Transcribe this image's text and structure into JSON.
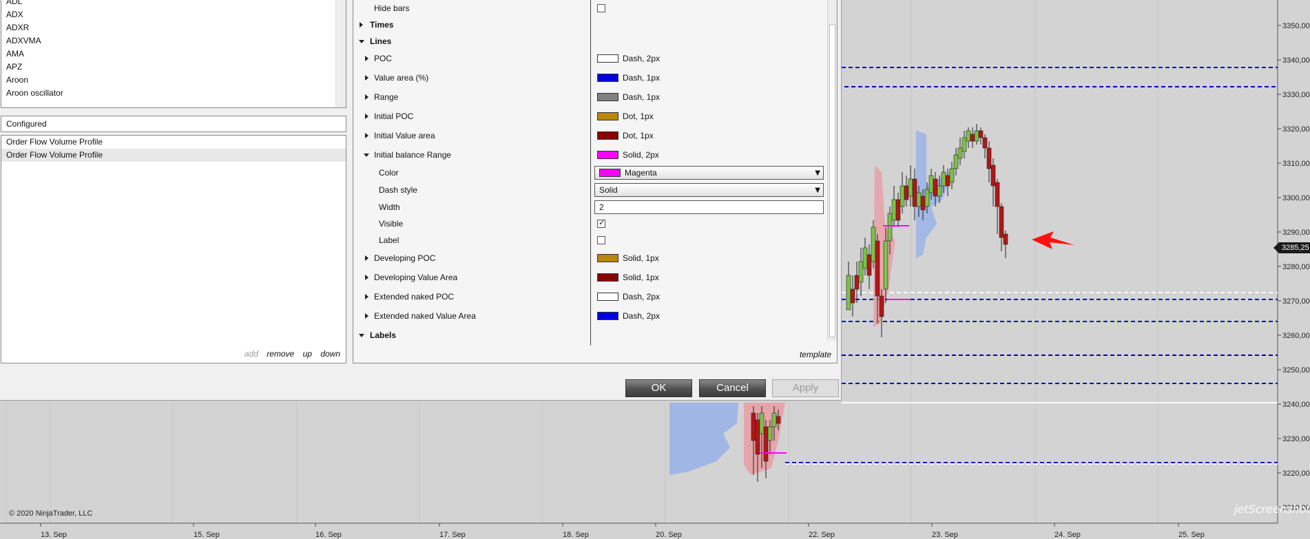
{
  "indicators": [
    "ADL",
    "ADX",
    "ADXR",
    "ADXVMA",
    "AMA",
    "APZ",
    "Aroon",
    "Aroon oscillator"
  ],
  "configured": {
    "header": "Configured",
    "items": [
      "Order Flow Volume Profile",
      "Order Flow Volume Profile"
    ],
    "actions": {
      "add": "add",
      "remove": "remove",
      "up": "up",
      "down": "down"
    }
  },
  "properties": {
    "hide_bars_label": "Hide bars",
    "times_label": "Times",
    "lines_label": "Lines",
    "labels_label": "Labels",
    "lines": [
      {
        "name": "POC",
        "color": "#ffffff",
        "value": "Dash, 2px"
      },
      {
        "name": "Value area (%)",
        "color": "#0000e0",
        "value": "Dash, 1px"
      },
      {
        "name": "Range",
        "color": "#808080",
        "value": "Dash, 1px"
      },
      {
        "name": "Initial POC",
        "color": "#b8860b",
        "value": "Dot, 1px"
      },
      {
        "name": "Initial Value area",
        "color": "#8b0000",
        "value": "Dot, 1px"
      },
      {
        "name": "Initial balance Range",
        "color": "#ff00ff",
        "value": "Solid, 2px"
      }
    ],
    "ib_sub": {
      "color_label": "Color",
      "color_value": "Magenta",
      "color_hex": "#ff00ff",
      "dash_label": "Dash style",
      "dash_value": "Solid",
      "width_label": "Width",
      "width_value": "2",
      "visible_label": "Visible",
      "label_label": "Label"
    },
    "more_lines": [
      {
        "name": "Developing POC",
        "color": "#b8860b",
        "value": "Solid, 1px"
      },
      {
        "name": "Developing Value Area",
        "color": "#8b0000",
        "value": "Solid, 1px"
      },
      {
        "name": "Extended naked POC",
        "color": "#ffffff",
        "value": "Dash, 2px"
      },
      {
        "name": "Extended naked Value Area",
        "color": "#0000e0",
        "value": "Dash, 2px"
      }
    ],
    "template_label": "template"
  },
  "buttons": {
    "ok": "OK",
    "cancel": "Cancel",
    "apply": "Apply"
  },
  "chart": {
    "copyright": "© 2020 NinjaTrader, LLC",
    "current_price": "3285,25",
    "price_ticks": [
      "3350,00",
      "3340,00",
      "3330,00",
      "3320,00",
      "3310,00",
      "3300,00",
      "3290,00",
      "3280,00",
      "3270,00",
      "3260,00",
      "3250,00",
      "3240,00",
      "3230,00",
      "3220,00",
      "3210,00"
    ],
    "date_ticks": [
      "13. Sep",
      "15. Sep",
      "16. Sep",
      "17. Sep",
      "18. Sep",
      "20. Sep",
      "22. Sep",
      "23. Sep",
      "24. Sep",
      "25. Sep"
    ],
    "watermark": "jetScreenshot"
  }
}
